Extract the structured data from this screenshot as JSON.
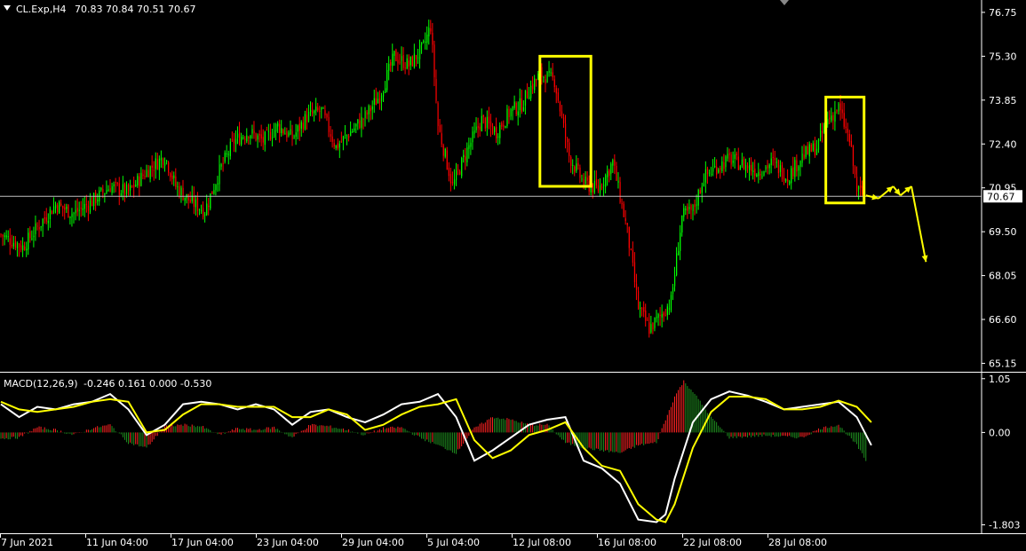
{
  "header": {
    "symbol_label": "CL.Exp,H4",
    "ohlc_text": "70.83 70.84 70.51 70.67"
  },
  "current_price_label": "70.67",
  "macd": {
    "label": "MACD(12,26,9)",
    "values_text": "-0.246 0.161 0.000 -0.530"
  },
  "colors": {
    "background": "#000000",
    "bull_candle": "#00ff00",
    "bear_candle": "#ff0000",
    "highlight_box": "#ffff00",
    "macd_line": "#ffffff",
    "signal_line": "#ffff00",
    "axis": "#ffffff"
  },
  "chart_data": [
    {
      "type": "candlestick",
      "title": "CL.Exp,H4",
      "price_ticks": [
        76.75,
        75.3,
        73.85,
        72.4,
        70.95,
        69.5,
        68.05,
        66.6,
        65.15
      ],
      "price_ticks_text": [
        "76.75",
        "75.30",
        "73.85",
        "72.40",
        "70.95",
        "69.50",
        "68.05",
        "66.60",
        "65.15"
      ],
      "ylim": [
        64.9,
        77.1
      ],
      "current_price": 70.67,
      "time_labels": [
        "7 Jun 2021",
        "11 Jun 04:00",
        "17 Jun 04:00",
        "23 Jun 04:00",
        "29 Jun 04:00",
        "5 Jul 04:00",
        "12 Jul 08:00",
        "16 Jul 08:00",
        "22 Jul 08:00",
        "28 Jul 08:00"
      ],
      "close_path": [
        [
          0,
          69.4
        ],
        [
          12,
          69.0
        ],
        [
          22,
          69.8
        ],
        [
          30,
          70.4
        ],
        [
          40,
          70.1
        ],
        [
          50,
          70.5
        ],
        [
          60,
          71.0
        ],
        [
          70,
          70.8
        ],
        [
          80,
          71.5
        ],
        [
          90,
          72.0
        ],
        [
          96,
          71.0
        ],
        [
          104,
          70.5
        ],
        [
          112,
          70.2
        ],
        [
          120,
          71.5
        ],
        [
          128,
          72.5
        ],
        [
          136,
          72.8
        ],
        [
          144,
          72.5
        ],
        [
          152,
          73.0
        ],
        [
          160,
          72.6
        ],
        [
          168,
          73.3
        ],
        [
          176,
          73.5
        ],
        [
          184,
          72.3
        ],
        [
          192,
          72.8
        ],
        [
          200,
          73.3
        ],
        [
          208,
          74.0
        ],
        [
          216,
          75.3
        ],
        [
          224,
          75.0
        ],
        [
          232,
          75.6
        ],
        [
          236,
          76.3
        ],
        [
          240,
          73.0
        ],
        [
          248,
          71.0
        ],
        [
          256,
          72.2
        ],
        [
          264,
          73.2
        ],
        [
          272,
          72.8
        ],
        [
          280,
          73.5
        ],
        [
          286,
          73.7
        ],
        [
          290,
          74.2
        ],
        [
          296,
          74.7
        ],
        [
          304,
          74.5
        ],
        [
          312,
          72.0
        ],
        [
          320,
          71.1
        ],
        [
          328,
          70.9
        ],
        [
          336,
          71.8
        ],
        [
          344,
          69.5
        ],
        [
          350,
          67.0
        ],
        [
          356,
          66.3
        ],
        [
          362,
          66.7
        ],
        [
          368,
          67.2
        ],
        [
          374,
          70.0
        ],
        [
          380,
          70.2
        ],
        [
          386,
          71.3
        ],
        [
          392,
          71.6
        ],
        [
          400,
          71.9
        ],
        [
          408,
          71.7
        ],
        [
          416,
          71.5
        ],
        [
          424,
          71.8
        ],
        [
          432,
          71.3
        ],
        [
          440,
          72.0
        ],
        [
          448,
          72.3
        ],
        [
          454,
          73.2
        ],
        [
          460,
          73.6
        ],
        [
          466,
          72.5
        ],
        [
          470,
          70.9
        ],
        [
          474,
          70.7
        ]
      ],
      "close_path_xmax": 520,
      "highlight_boxes": [
        {
          "x_from": 296,
          "x_to": 324,
          "y_from": 71.0,
          "y_to": 75.3
        },
        {
          "x_from": 453,
          "x_to": 474,
          "y_from": 70.45,
          "y_to": 73.95
        }
      ],
      "forecast_path": [
        [
          475,
          70.7
        ],
        [
          482,
          70.6
        ],
        [
          490,
          71.0
        ],
        [
          494,
          70.7
        ],
        [
          500,
          71.0
        ],
        [
          508,
          68.5
        ]
      ]
    },
    {
      "type": "line",
      "title": "MACD(12,26,9)",
      "y_ticks": [
        1.05,
        0.0,
        -1.803
      ],
      "y_ticks_text": [
        "1.05",
        "0.00",
        "-1.803"
      ],
      "ylim": [
        -1.95,
        1.15
      ],
      "series": [
        {
          "name": "MACD(12,26,9)",
          "kind": "histogram",
          "x": [
            0,
            10,
            20,
            30,
            40,
            50,
            60,
            70,
            80,
            90,
            100,
            110,
            120,
            130,
            140,
            150,
            160,
            170,
            180,
            190,
            200,
            210,
            220,
            230,
            240,
            250,
            260,
            270,
            280,
            290,
            300,
            310,
            320,
            330,
            340,
            350,
            360,
            370,
            375,
            380,
            390,
            400,
            410,
            420,
            430,
            440,
            450,
            460,
            470,
            475
          ],
          "values": [
            -0.12,
            -0.1,
            0.1,
            0.05,
            -0.05,
            0.08,
            0.15,
            -0.2,
            -0.3,
            0.12,
            0.15,
            0.12,
            -0.05,
            0.08,
            0.05,
            0.1,
            -0.1,
            0.15,
            0.12,
            0.05,
            -0.05,
            0.08,
            0.1,
            -0.1,
            -0.25,
            -0.4,
            0.08,
            0.3,
            0.25,
            0.15,
            0.15,
            -0.2,
            -0.3,
            -0.35,
            -0.4,
            -0.25,
            -0.2,
            0.7,
            1.0,
            0.8,
            0.3,
            -0.1,
            -0.08,
            -0.06,
            -0.08,
            -0.1,
            0.08,
            0.15,
            -0.25,
            -0.55
          ]
        },
        {
          "name": "MACD",
          "x": [
            0,
            10,
            20,
            30,
            40,
            50,
            60,
            70,
            80,
            90,
            100,
            110,
            120,
            130,
            140,
            150,
            160,
            170,
            180,
            190,
            200,
            210,
            220,
            230,
            240,
            250,
            260,
            270,
            280,
            290,
            300,
            310,
            320,
            330,
            340,
            350,
            360,
            365,
            370,
            380,
            390,
            400,
            410,
            420,
            430,
            440,
            450,
            460,
            470,
            478
          ],
          "values": [
            0.55,
            0.3,
            0.5,
            0.45,
            0.55,
            0.6,
            0.75,
            0.45,
            -0.05,
            0.15,
            0.55,
            0.6,
            0.55,
            0.45,
            0.55,
            0.45,
            0.15,
            0.4,
            0.45,
            0.3,
            0.2,
            0.35,
            0.55,
            0.6,
            0.75,
            0.3,
            -0.55,
            -0.35,
            -0.1,
            0.15,
            0.25,
            0.3,
            -0.55,
            -0.7,
            -1.0,
            -1.7,
            -1.75,
            -1.6,
            -0.9,
            0.2,
            0.65,
            0.8,
            0.72,
            0.6,
            0.45,
            0.5,
            0.55,
            0.6,
            0.3,
            -0.25
          ]
        },
        {
          "name": "Signal",
          "x": [
            0,
            10,
            20,
            30,
            40,
            50,
            60,
            70,
            80,
            90,
            100,
            110,
            120,
            130,
            140,
            150,
            160,
            170,
            180,
            190,
            200,
            210,
            220,
            230,
            240,
            250,
            260,
            270,
            280,
            290,
            300,
            310,
            320,
            330,
            340,
            350,
            360,
            365,
            370,
            380,
            390,
            400,
            410,
            420,
            430,
            440,
            450,
            460,
            470,
            478
          ],
          "values": [
            0.6,
            0.45,
            0.4,
            0.45,
            0.5,
            0.6,
            0.65,
            0.6,
            0.0,
            0.05,
            0.35,
            0.55,
            0.55,
            0.5,
            0.5,
            0.5,
            0.3,
            0.3,
            0.45,
            0.35,
            0.05,
            0.15,
            0.35,
            0.5,
            0.55,
            0.65,
            -0.15,
            -0.5,
            -0.35,
            -0.05,
            0.05,
            0.2,
            -0.3,
            -0.65,
            -0.75,
            -1.4,
            -1.7,
            -1.75,
            -1.4,
            -0.3,
            0.4,
            0.7,
            0.7,
            0.65,
            0.45,
            0.45,
            0.5,
            0.62,
            0.5,
            0.2
          ]
        }
      ]
    }
  ]
}
